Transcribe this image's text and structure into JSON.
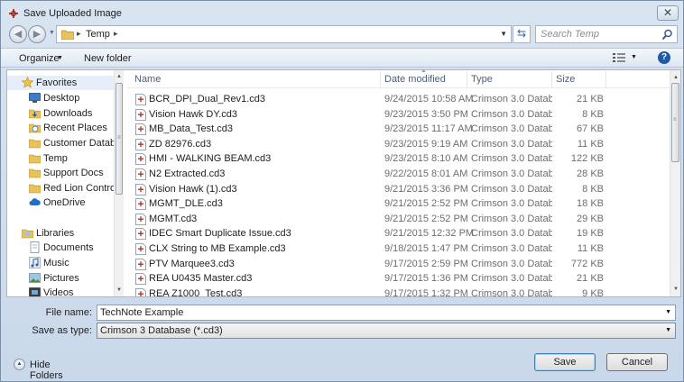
{
  "window": {
    "title": "Save Uploaded Image",
    "close_label": "✕"
  },
  "address_bar": {
    "path": [
      "Temp"
    ],
    "search_placeholder": "Search Temp"
  },
  "toolbar": {
    "organize": "Organize",
    "new_folder": "New folder"
  },
  "nav_pane": {
    "favorites_label": "Favorites",
    "favorites": [
      "Desktop",
      "Downloads",
      "Recent Places",
      "Customer Databa",
      "Temp",
      "Support Docs",
      "Red Lion Control",
      "OneDrive"
    ],
    "libraries_label": "Libraries",
    "libraries": [
      "Documents",
      "Music",
      "Pictures",
      "Videos"
    ]
  },
  "file_list": {
    "columns": {
      "name": "Name",
      "date": "Date modified",
      "type": "Type",
      "size": "Size"
    },
    "rows": [
      {
        "name": "BCR_DPI_Dual_Rev1.cd3",
        "date": "9/24/2015 10:58 AM",
        "type": "Crimson 3.0 Datab...",
        "size": "21 KB"
      },
      {
        "name": "Vision Hawk DY.cd3",
        "date": "9/23/2015 3:50 PM",
        "type": "Crimson 3.0 Datab...",
        "size": "8 KB"
      },
      {
        "name": "MB_Data_Test.cd3",
        "date": "9/23/2015 11:17 AM",
        "type": "Crimson 3.0 Datab...",
        "size": "67 KB"
      },
      {
        "name": "ZD 82976.cd3",
        "date": "9/23/2015 9:19 AM",
        "type": "Crimson 3.0 Datab...",
        "size": "11 KB"
      },
      {
        "name": "HMI - WALKING BEAM.cd3",
        "date": "9/23/2015 8:10 AM",
        "type": "Crimson 3.0 Datab...",
        "size": "122 KB"
      },
      {
        "name": "N2 Extracted.cd3",
        "date": "9/22/2015 8:01 AM",
        "type": "Crimson 3.0 Datab...",
        "size": "28 KB"
      },
      {
        "name": "Vision Hawk (1).cd3",
        "date": "9/21/2015 3:36 PM",
        "type": "Crimson 3.0 Datab...",
        "size": "8 KB"
      },
      {
        "name": "MGMT_DLE.cd3",
        "date": "9/21/2015 2:52 PM",
        "type": "Crimson 3.0 Datab...",
        "size": "18 KB"
      },
      {
        "name": "MGMT.cd3",
        "date": "9/21/2015 2:52 PM",
        "type": "Crimson 3.0 Datab...",
        "size": "29 KB"
      },
      {
        "name": "IDEC Smart Duplicate Issue.cd3",
        "date": "9/21/2015 12:32 PM",
        "type": "Crimson 3.0 Datab...",
        "size": "19 KB"
      },
      {
        "name": "CLX String to MB Example.cd3",
        "date": "9/18/2015 1:47 PM",
        "type": "Crimson 3.0 Datab...",
        "size": "11 KB"
      },
      {
        "name": "PTV Marquee3.cd3",
        "date": "9/17/2015 2:59 PM",
        "type": "Crimson 3.0 Datab...",
        "size": "772 KB"
      },
      {
        "name": "REA U0435 Master.cd3",
        "date": "9/17/2015 1:36 PM",
        "type": "Crimson 3.0 Datab...",
        "size": "21 KB"
      },
      {
        "name": "REA Z1000_Test.cd3",
        "date": "9/17/2015 1:32 PM",
        "type": "Crimson 3.0 Datab...",
        "size": "9 KB"
      }
    ]
  },
  "form": {
    "file_name_label": "File name:",
    "file_name_value": "TechNote Example",
    "save_type_label": "Save as type:",
    "save_type_value": "Crimson 3 Database (*.cd3)"
  },
  "footer": {
    "hide_folders": "Hide Folders",
    "save": "Save",
    "cancel": "Cancel"
  }
}
